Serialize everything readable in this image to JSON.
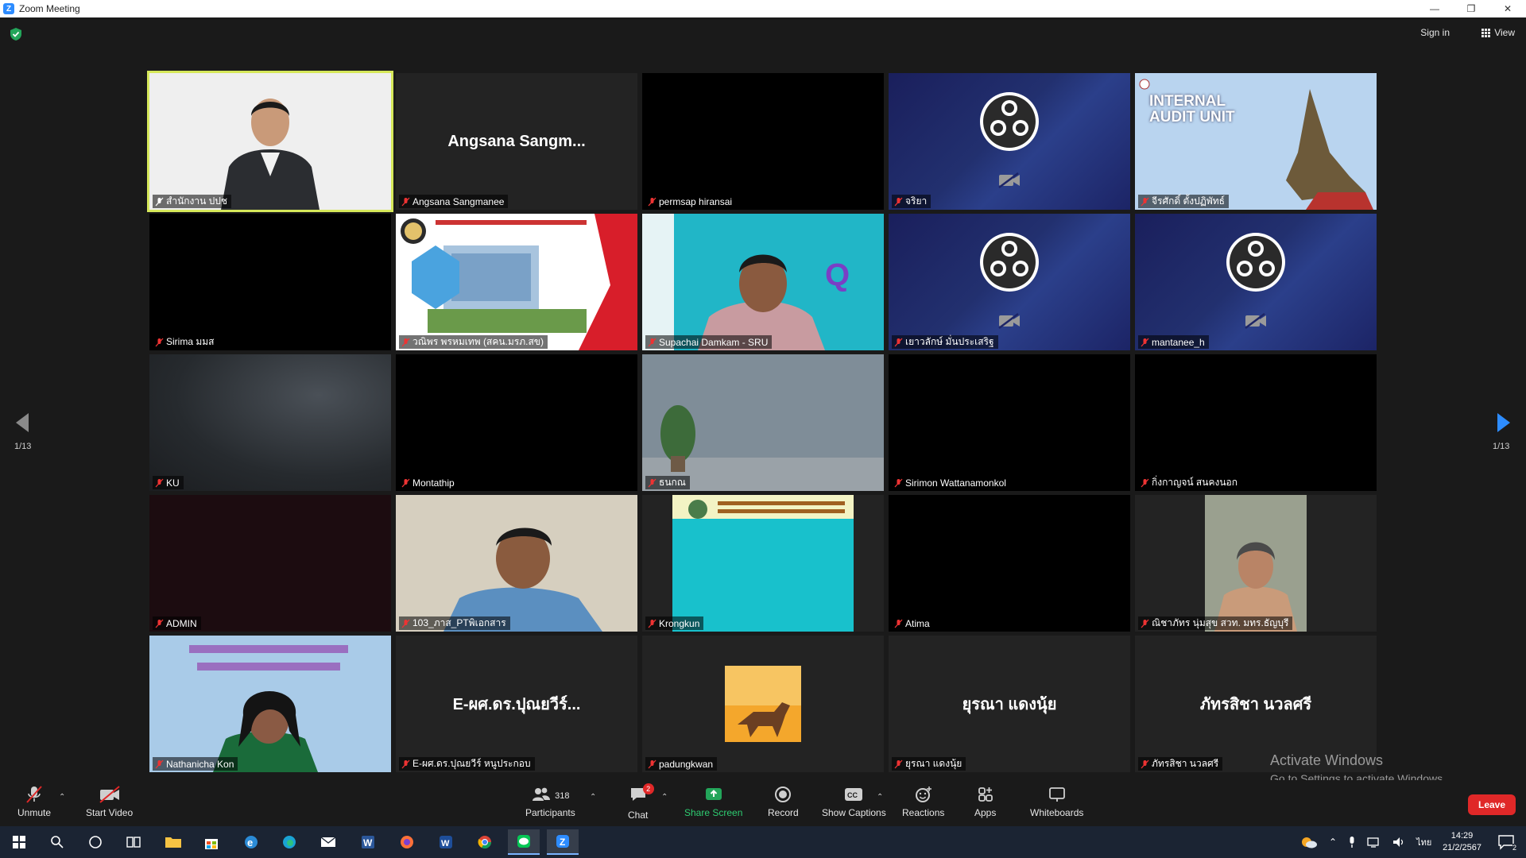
{
  "window": {
    "title": "Zoom Meeting",
    "minimize": "—",
    "restore": "❐",
    "close": "✕"
  },
  "topbar": {
    "signin_label": "Sign in",
    "view_label": "View"
  },
  "pagination": {
    "left": "1/13",
    "right": "1/13"
  },
  "tiles": [
    {
      "name": "สำนักงาน ปปช",
      "bigname": ""
    },
    {
      "name": "Angsana Sangmanee",
      "bigname": "Angsana  Sangm..."
    },
    {
      "name": "permsap hiransai",
      "bigname": ""
    },
    {
      "name": "จริยา",
      "bigname": ""
    },
    {
      "name": "จีรศักดิ์ ตั้งปฏิพัทธ์",
      "bigname": ""
    },
    {
      "name": "Sirima มมส",
      "bigname": ""
    },
    {
      "name": "วณิพร พรหมเทพ (สคน.มรภ.สข)",
      "bigname": ""
    },
    {
      "name": "Supachai Damkam - SRU",
      "bigname": ""
    },
    {
      "name": "เยาวลักษ์ มั่นประเสริฐ",
      "bigname": ""
    },
    {
      "name": "mantanee_h",
      "bigname": ""
    },
    {
      "name": "KU",
      "bigname": ""
    },
    {
      "name": "Montathip",
      "bigname": ""
    },
    {
      "name": "ธนกณ",
      "bigname": ""
    },
    {
      "name": "Sirimon Wattanamonkol",
      "bigname": ""
    },
    {
      "name": "กิ่งกาญจน์ สนคงนอก",
      "bigname": ""
    },
    {
      "name": "ADMIN",
      "bigname": ""
    },
    {
      "name": "103_ภาส_PTพิเอกสาร",
      "bigname": ""
    },
    {
      "name": "Krongkun",
      "bigname": ""
    },
    {
      "name": "Atima",
      "bigname": ""
    },
    {
      "name": "ณิชาภัทร นุ่มสุข สวท. มทร.ธัญบุรี",
      "bigname": ""
    },
    {
      "name": "Nathanicha Kon",
      "bigname": ""
    },
    {
      "name": "E-ผศ.ดร.ปุณยวีร์ หนูประกอบ",
      "bigname": "E-ผศ.ดร.ปุณยวีร์..."
    },
    {
      "name": "padungkwan",
      "bigname": ""
    },
    {
      "name": "ยุรณา  แดงนุ้ย",
      "bigname": "ยุรณา  แดงนุ้ย"
    },
    {
      "name": "ภัทรสิชา นวลศรี",
      "bigname": "ภัทรสิชา นวลศรี"
    }
  ],
  "audit_slide": {
    "line1": "INTERNAL",
    "line2": "AUDIT UNIT"
  },
  "watermark": {
    "line1": "Activate Windows",
    "line2": "Go to Settings to activate Windows."
  },
  "toolbar": {
    "unmute": "Unmute",
    "start_video": "Start Video",
    "participants": "Participants",
    "participants_count": "318",
    "chat": "Chat",
    "chat_badge": "2",
    "share_screen": "Share Screen",
    "record": "Record",
    "show_captions": "Show Captions",
    "reactions": "Reactions",
    "apps": "Apps",
    "whiteboards": "Whiteboards",
    "leave": "Leave"
  },
  "taskbar": {
    "time": "14:29",
    "date": "21/2/2567",
    "lang": "ไทย",
    "notif": "2"
  },
  "colors": {
    "accent": "#2d8cff",
    "active_speaker": "#d6e85a",
    "leave": "#e02828",
    "share": "#2ecc71"
  }
}
